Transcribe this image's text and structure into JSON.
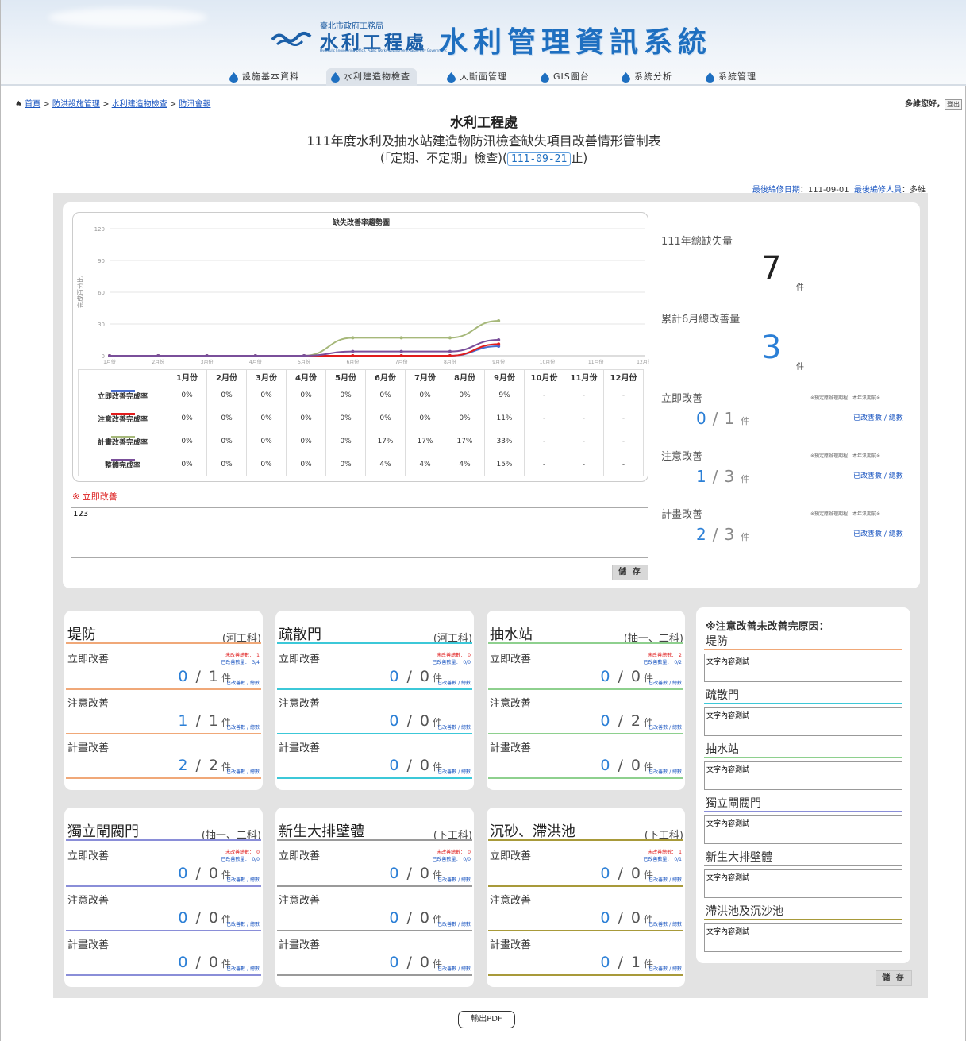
{
  "header": {
    "org_small": "臺北市政府工務局",
    "org_name": "水利工程處",
    "org_en": "Hydraulic Engineering Office, Public Works Department, Taipei City Government",
    "system_title": "水利管理資訊系統",
    "nav": [
      {
        "label": "設施基本資料",
        "active": false
      },
      {
        "label": "水利建造物檢查",
        "active": true
      },
      {
        "label": "大斷面管理",
        "active": false
      },
      {
        "label": "GIS圖台",
        "active": false
      },
      {
        "label": "系統分析",
        "active": false
      },
      {
        "label": "系統管理",
        "active": false
      }
    ],
    "accent": "#1e6fc0"
  },
  "breadcrumb": [
    "首頁",
    "防洪設施管理",
    "水利建造物檢查",
    "防汛會報"
  ],
  "user": {
    "greeting": "多維您好，",
    "logout": "登出"
  },
  "titles": {
    "dept": "水利工程處",
    "main": "111年度水利及抽水站建造物防汛檢查缺失項目改善情形管制表",
    "sub_prefix": "(「定期、不定期」檢查)(",
    "date": "111-09-21",
    "sub_suffix": "止)"
  },
  "edit_info": {
    "date_label": "最後編修日期",
    "date": "：111-09-01",
    "person_label": "最後編修人員",
    "person": "：多維"
  },
  "chart_data": {
    "type": "line",
    "title": "缺失改善率趨勢圖",
    "ylabel": "完成百分比",
    "ylim": [
      0,
      120
    ],
    "yticks": [
      0,
      30,
      60,
      90,
      120
    ],
    "categories": [
      "1月份",
      "2月份",
      "3月份",
      "4月份",
      "5月份",
      "6月份",
      "7月份",
      "8月份",
      "9月份",
      "10月份",
      "11月份",
      "12月份"
    ],
    "series": [
      {
        "name": "立即改善完成率",
        "color": "#4a6fd0",
        "values": [
          0,
          0,
          0,
          0,
          0,
          0,
          0,
          0,
          9,
          null,
          null,
          null
        ]
      },
      {
        "name": "注意改善完成率",
        "color": "#e21c1c",
        "values": [
          0,
          0,
          0,
          0,
          0,
          0,
          0,
          0,
          11,
          null,
          null,
          null
        ]
      },
      {
        "name": "計畫改善完成率",
        "color": "#a6b87a",
        "values": [
          0,
          0,
          0,
          0,
          0,
          17,
          17,
          17,
          33,
          null,
          null,
          null
        ]
      },
      {
        "name": "整體完成率",
        "color": "#7a4f9a",
        "values": [
          0,
          0,
          0,
          0,
          0,
          4,
          4,
          4,
          15,
          null,
          null,
          null
        ]
      }
    ],
    "table_rows": [
      [
        "0%",
        "0%",
        "0%",
        "0%",
        "0%",
        "0%",
        "0%",
        "0%",
        "9%",
        "-",
        "-",
        "-"
      ],
      [
        "0%",
        "0%",
        "0%",
        "0%",
        "0%",
        "0%",
        "0%",
        "0%",
        "11%",
        "-",
        "-",
        "-"
      ],
      [
        "0%",
        "0%",
        "0%",
        "0%",
        "0%",
        "17%",
        "17%",
        "17%",
        "33%",
        "-",
        "-",
        "-"
      ],
      [
        "0%",
        "0%",
        "0%",
        "0%",
        "0%",
        "4%",
        "4%",
        "4%",
        "15%",
        "-",
        "-",
        "-"
      ]
    ]
  },
  "immediate_note": {
    "label": "※ 立即改善",
    "value": "123",
    "save": "儲 存"
  },
  "stats": {
    "total_label": "111年總缺失量",
    "total": "7",
    "unit": "件",
    "improved_label": "累計6月總改善量",
    "improved": "3",
    "groups": [
      {
        "label": "立即改善",
        "note": "※預定應辦理期程：本年汛期前※",
        "done": "0",
        "total": "1",
        "link": "已改善數 / 總數"
      },
      {
        "label": "注意改善",
        "note": "※預定應辦理期程：本年汛期前※",
        "done": "1",
        "total": "3",
        "link": "已改善數 / 總數"
      },
      {
        "label": "計畫改善",
        "note": "※預定應辦理期程：本年汛期前※",
        "done": "2",
        "total": "3",
        "link": "已改善數 / 總數"
      }
    ]
  },
  "facilities": [
    {
      "name": "堤防",
      "dept": "(河工科)",
      "color": "#f0a878",
      "unfixed": "未改善總數：　1",
      "fixed": "已改善數量：　3/4",
      "rows": [
        [
          "立即改善",
          "0",
          "1"
        ],
        [
          "注意改善",
          "1",
          "1"
        ],
        [
          "計畫改善",
          "2",
          "2"
        ]
      ]
    },
    {
      "name": "疏散門",
      "dept": "(河工科)",
      "color": "#3cc8d8",
      "unfixed": "未改善總數：　0",
      "fixed": "已改善數量：　0/0",
      "rows": [
        [
          "立即改善",
          "0",
          "0"
        ],
        [
          "注意改善",
          "0",
          "0"
        ],
        [
          "計畫改善",
          "0",
          "0"
        ]
      ]
    },
    {
      "name": "抽水站",
      "dept": "(抽一、二科)",
      "color": "#8ed08e",
      "unfixed": "未改善總數：　2",
      "fixed": "已改善數量：　0/2",
      "rows": [
        [
          "立即改善",
          "0",
          "0"
        ],
        [
          "注意改善",
          "0",
          "2"
        ],
        [
          "計畫改善",
          "0",
          "0"
        ]
      ]
    },
    {
      "name": "獨立閘閥門",
      "dept": "(抽一、二科)",
      "color": "#8a8ed8",
      "unfixed": "未改善總數：　0",
      "fixed": "已改善數量：　0/0",
      "rows": [
        [
          "立即改善",
          "0",
          "0"
        ],
        [
          "注意改善",
          "0",
          "0"
        ],
        [
          "計畫改善",
          "0",
          "0"
        ]
      ]
    },
    {
      "name": "新生大排壁體",
      "dept": "(下工科)",
      "color": "#9a9a9a",
      "unfixed": "未改善總數：　0",
      "fixed": "已改善數量：　0/0",
      "rows": [
        [
          "立即改善",
          "0",
          "0"
        ],
        [
          "注意改善",
          "0",
          "0"
        ],
        [
          "計畫改善",
          "0",
          "0"
        ]
      ]
    },
    {
      "name": "沉砂、滯洪池",
      "dept": "(下工科)",
      "color": "#a89a3a",
      "unfixed": "未改善總數：　1",
      "fixed": "已改善數量：　0/1",
      "rows": [
        [
          "立即改善",
          "0",
          "0"
        ],
        [
          "注意改善",
          "0",
          "0"
        ],
        [
          "計畫改善",
          "0",
          "1"
        ]
      ]
    }
  ],
  "small_link": "已改善數 / 總數",
  "unit": "件",
  "reasons": {
    "head": "※注意改善未改善完原因：",
    "items": [
      {
        "name": "堤防",
        "text": "文字內容測試",
        "color": "#f0a878"
      },
      {
        "name": "疏散門",
        "text": "文字內容測試",
        "color": "#3cc8d8"
      },
      {
        "name": "抽水站",
        "text": "文字內容測試",
        "color": "#8ed08e"
      },
      {
        "name": "獨立閘閥門",
        "text": "文字內容測試",
        "color": "#8a8ed8"
      },
      {
        "name": "新生大排壁體",
        "text": "文字內容測試",
        "color": "#9a9a9a"
      },
      {
        "name": "滯洪池及沉沙池",
        "text": "文字內容測試",
        "color": "#a89a3a"
      }
    ],
    "save": "儲 存"
  },
  "pdf_button": "輸出PDF"
}
